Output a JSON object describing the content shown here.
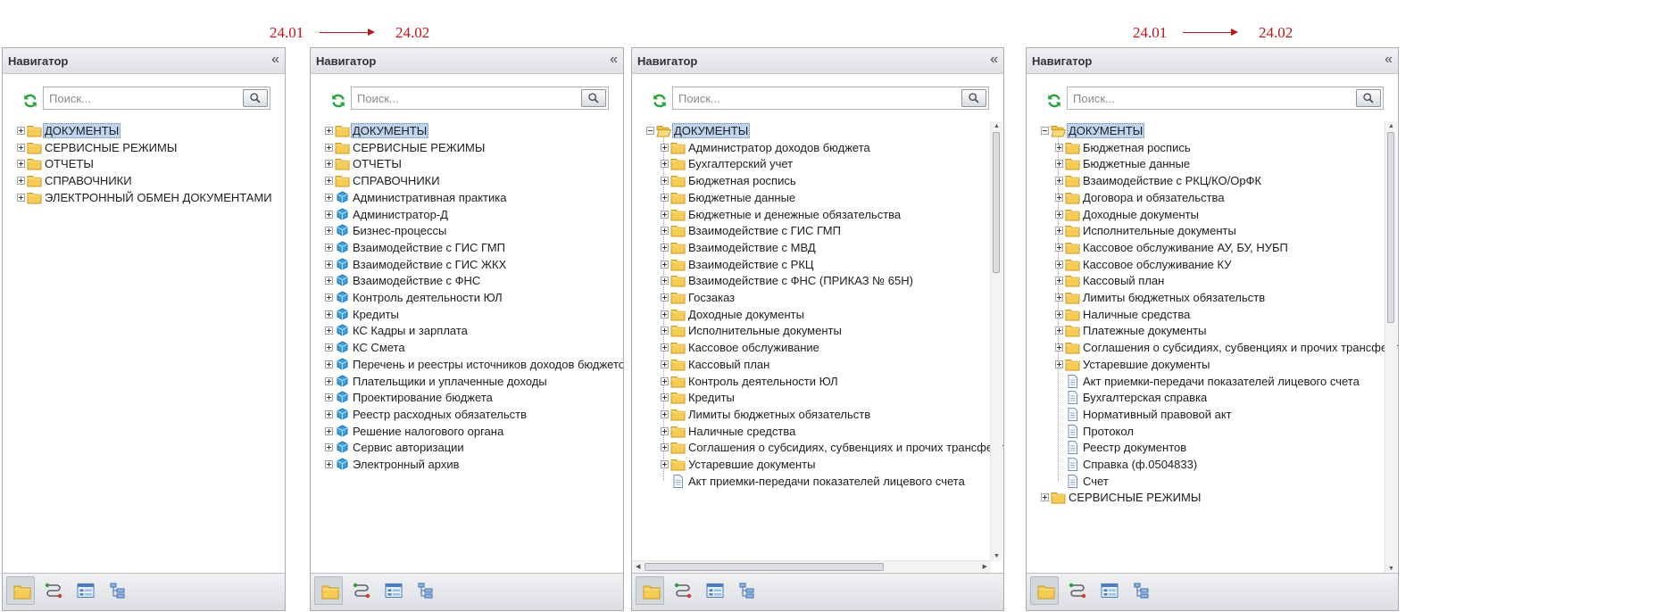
{
  "versions": {
    "from": "24.01",
    "to": "24.02"
  },
  "panel_title": "Навигатор",
  "collapse_glyph": "«",
  "search_placeholder": "Поиск...",
  "toolbar_icons": [
    "folder-icon",
    "routes-icon",
    "form-icon",
    "tree-icon"
  ],
  "icons": {
    "expand": "plus-box-icon",
    "collapse": "minus-box-icon",
    "folder": "folder-icon",
    "open_folder": "open-folder-icon",
    "module": "cube-icon",
    "document": "document-icon"
  },
  "colors": {
    "version_label": "#c0141b",
    "folder": "#f6cc52",
    "module": "#3a9fe0",
    "selection": "#bfd5ef",
    "refresh": "#27a33b"
  },
  "panels": [
    {
      "items": [
        {
          "label": "ДОКУМЕНТЫ",
          "type": "folder",
          "expander": "plus",
          "selected": true
        },
        {
          "label": "СЕРВИСНЫЕ РЕЖИМЫ",
          "type": "folder",
          "expander": "plus"
        },
        {
          "label": "ОТЧЕТЫ",
          "type": "folder",
          "expander": "plus"
        },
        {
          "label": "СПРАВОЧНИКИ",
          "type": "folder",
          "expander": "plus"
        },
        {
          "label": "ЭЛЕКТРОННЫЙ ОБМЕН ДОКУМЕНТАМИ",
          "type": "folder",
          "expander": "plus"
        }
      ]
    },
    {
      "items": [
        {
          "label": "ДОКУМЕНТЫ",
          "type": "folder",
          "expander": "plus",
          "selected": true
        },
        {
          "label": "СЕРВИСНЫЕ РЕЖИМЫ",
          "type": "folder",
          "expander": "plus"
        },
        {
          "label": "ОТЧЕТЫ",
          "type": "folder",
          "expander": "plus"
        },
        {
          "label": "СПРАВОЧНИКИ",
          "type": "folder",
          "expander": "plus"
        },
        {
          "label": "Административная практика",
          "type": "module",
          "expander": "plus"
        },
        {
          "label": "Администратор-Д",
          "type": "module",
          "expander": "plus"
        },
        {
          "label": "Бизнес-процессы",
          "type": "module",
          "expander": "plus"
        },
        {
          "label": "Взаимодействие с ГИС ГМП",
          "type": "module",
          "expander": "plus"
        },
        {
          "label": "Взаимодействие с ГИС ЖКХ",
          "type": "module",
          "expander": "plus"
        },
        {
          "label": "Взаимодействие с ФНС",
          "type": "module",
          "expander": "plus"
        },
        {
          "label": "Контроль деятельности ЮЛ",
          "type": "module",
          "expander": "plus"
        },
        {
          "label": "Кредиты",
          "type": "module",
          "expander": "plus"
        },
        {
          "label": "КС Кадры и зарплата",
          "type": "module",
          "expander": "plus"
        },
        {
          "label": "КС Смета",
          "type": "module",
          "expander": "plus"
        },
        {
          "label": "Перечень и реестры источников доходов бюджетов",
          "type": "module",
          "expander": "plus"
        },
        {
          "label": "Плательщики и уплаченные доходы",
          "type": "module",
          "expander": "plus"
        },
        {
          "label": "Проектирование бюджета",
          "type": "module",
          "expander": "plus"
        },
        {
          "label": "Реестр расходных обязательств",
          "type": "module",
          "expander": "plus"
        },
        {
          "label": "Решение налогового органа",
          "type": "module",
          "expander": "plus"
        },
        {
          "label": "Сервис авторизации",
          "type": "module",
          "expander": "plus"
        },
        {
          "label": "Электронный архив",
          "type": "module",
          "expander": "plus"
        }
      ]
    },
    {
      "items": [
        {
          "label": "ДОКУМЕНТЫ",
          "type": "open_folder",
          "expander": "minus",
          "selected": true
        },
        {
          "label": "Администратор доходов бюджета",
          "type": "folder",
          "expander": "plus",
          "indent": 1
        },
        {
          "label": "Бухгалтерский учет",
          "type": "folder",
          "expander": "plus",
          "indent": 1
        },
        {
          "label": "Бюджетная роспись",
          "type": "folder",
          "expander": "plus",
          "indent": 1
        },
        {
          "label": "Бюджетные данные",
          "type": "folder",
          "expander": "plus",
          "indent": 1
        },
        {
          "label": "Бюджетные и денежные обязательства",
          "type": "folder",
          "expander": "plus",
          "indent": 1
        },
        {
          "label": "Взаимодействие с ГИС ГМП",
          "type": "folder",
          "expander": "plus",
          "indent": 1
        },
        {
          "label": "Взаимодействие с МВД",
          "type": "folder",
          "expander": "plus",
          "indent": 1
        },
        {
          "label": "Взаимодействие с РКЦ",
          "type": "folder",
          "expander": "plus",
          "indent": 1
        },
        {
          "label": "Взаимодействие с ФНС (ПРИКАЗ № 65Н)",
          "type": "folder",
          "expander": "plus",
          "indent": 1
        },
        {
          "label": "Госзаказ",
          "type": "folder",
          "expander": "plus",
          "indent": 1
        },
        {
          "label": "Доходные документы",
          "type": "folder",
          "expander": "plus",
          "indent": 1
        },
        {
          "label": "Исполнительные документы",
          "type": "folder",
          "expander": "plus",
          "indent": 1
        },
        {
          "label": "Кассовое обслуживание",
          "type": "folder",
          "expander": "plus",
          "indent": 1
        },
        {
          "label": "Кассовый план",
          "type": "folder",
          "expander": "plus",
          "indent": 1
        },
        {
          "label": "Контроль деятельности ЮЛ",
          "type": "folder",
          "expander": "plus",
          "indent": 1
        },
        {
          "label": "Кредиты",
          "type": "folder",
          "expander": "plus",
          "indent": 1
        },
        {
          "label": "Лимиты бюджетных обязательств",
          "type": "folder",
          "expander": "plus",
          "indent": 1
        },
        {
          "label": "Наличные средства",
          "type": "folder",
          "expander": "plus",
          "indent": 1
        },
        {
          "label": "Соглашения о субсидиях, субвенциях и прочих трансфертах",
          "type": "folder",
          "expander": "plus",
          "indent": 1
        },
        {
          "label": "Устаревшие документы",
          "type": "folder",
          "expander": "plus",
          "indent": 1
        },
        {
          "label": "Акт приемки-передачи показателей лицевого счета",
          "type": "document",
          "expander": "none",
          "indent": 1
        }
      ]
    },
    {
      "items": [
        {
          "label": "ДОКУМЕНТЫ",
          "type": "open_folder",
          "expander": "minus",
          "selected": true
        },
        {
          "label": "Бюджетная роспись",
          "type": "folder",
          "expander": "plus",
          "indent": 1
        },
        {
          "label": "Бюджетные данные",
          "type": "folder",
          "expander": "plus",
          "indent": 1
        },
        {
          "label": "Взаимодействие с РКЦ/КО/ОрФК",
          "type": "folder",
          "expander": "plus",
          "indent": 1
        },
        {
          "label": "Договора и обязательства",
          "type": "folder",
          "expander": "plus",
          "indent": 1
        },
        {
          "label": "Доходные документы",
          "type": "folder",
          "expander": "plus",
          "indent": 1
        },
        {
          "label": "Исполнительные документы",
          "type": "folder",
          "expander": "plus",
          "indent": 1
        },
        {
          "label": "Кассовое обслуживание АУ, БУ, НУБП",
          "type": "folder",
          "expander": "plus",
          "indent": 1
        },
        {
          "label": "Кассовое обслуживание КУ",
          "type": "folder",
          "expander": "plus",
          "indent": 1
        },
        {
          "label": "Кассовый план",
          "type": "folder",
          "expander": "plus",
          "indent": 1
        },
        {
          "label": "Лимиты бюджетных обязательств",
          "type": "folder",
          "expander": "plus",
          "indent": 1
        },
        {
          "label": "Наличные средства",
          "type": "folder",
          "expander": "plus",
          "indent": 1
        },
        {
          "label": "Платежные документы",
          "type": "folder",
          "expander": "plus",
          "indent": 1
        },
        {
          "label": "Соглашения о субсидиях, субвенциях и прочих трансфертах",
          "type": "folder",
          "expander": "plus",
          "indent": 1
        },
        {
          "label": "Устаревшие документы",
          "type": "folder",
          "expander": "plus",
          "indent": 1
        },
        {
          "label": "Акт приемки-передачи показателей лицевого счета",
          "type": "document",
          "expander": "none",
          "indent": 1
        },
        {
          "label": "Бухгалтерская справка",
          "type": "document",
          "expander": "none",
          "indent": 1
        },
        {
          "label": "Нормативный правовой акт",
          "type": "document",
          "expander": "none",
          "indent": 1
        },
        {
          "label": "Протокол",
          "type": "document",
          "expander": "none",
          "indent": 1
        },
        {
          "label": "Реестр документов",
          "type": "document",
          "expander": "none",
          "indent": 1
        },
        {
          "label": "Справка (ф.0504833)",
          "type": "document",
          "expander": "none",
          "indent": 1
        },
        {
          "label": "Счет",
          "type": "document",
          "expander": "none",
          "indent": 1
        },
        {
          "label": "СЕРВИСНЫЕ РЕЖИМЫ",
          "type": "folder",
          "expander": "plus"
        }
      ]
    }
  ]
}
